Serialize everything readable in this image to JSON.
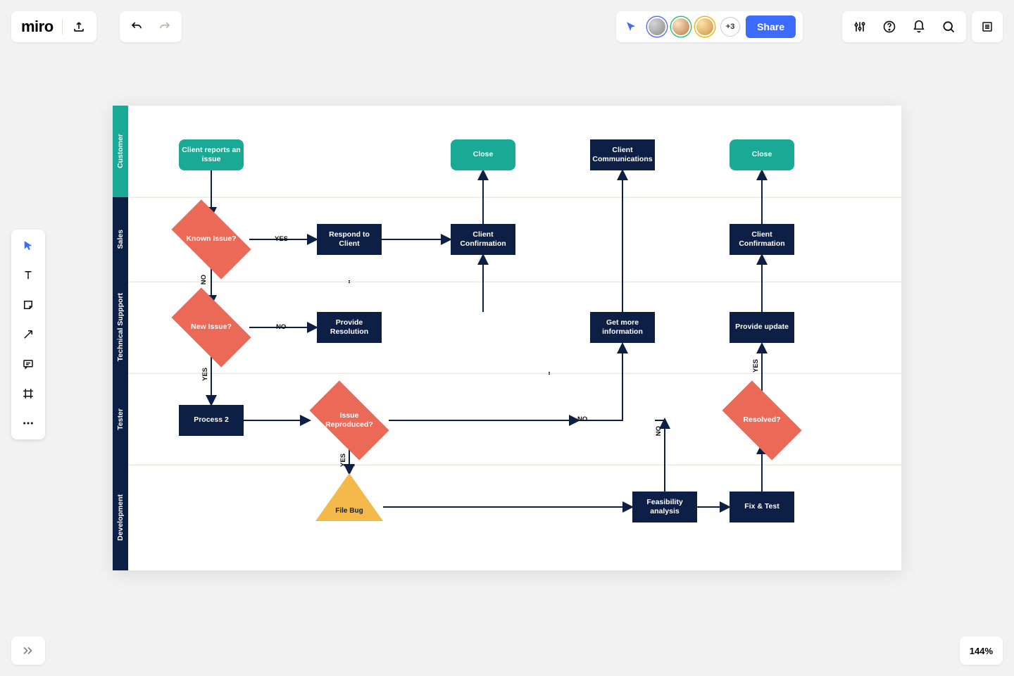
{
  "app": {
    "logo": "miro"
  },
  "toolbar": {
    "share": "Share",
    "more_users": "+3"
  },
  "zoom": "144%",
  "swimlanes": [
    "Customer",
    "Sales",
    "Technical Suppport",
    "Tester",
    "Development"
  ],
  "nodes": {
    "client_reports": "Client reports an issue",
    "close1": "Close",
    "client_comm": "Client Communications",
    "close2": "Close",
    "known_issue": "Known Issue?",
    "respond": "Respond to Client",
    "client_conf1": "Client Confirmation",
    "client_conf2": "Client Confirmation",
    "new_issue": "New Issue?",
    "provide_res": "Provide Resolution",
    "get_more": "Get more information",
    "provide_update": "Provide update",
    "process2": "Process 2",
    "issue_repro": "Issue Reproduced?",
    "resolved": "Resolved?",
    "file_bug": "File Bug",
    "feasibility": "Feasibility analysis",
    "fix_test": "Fix & Test"
  },
  "edges": {
    "yes": "YES",
    "no": "NO"
  },
  "chart_data": {
    "type": "swimlane-flowchart",
    "title": "",
    "lanes": [
      {
        "id": "customer",
        "label": "Customer"
      },
      {
        "id": "sales",
        "label": "Sales"
      },
      {
        "id": "tech",
        "label": "Technical Suppport"
      },
      {
        "id": "tester",
        "label": "Tester"
      },
      {
        "id": "dev",
        "label": "Development"
      }
    ],
    "nodes": [
      {
        "id": "client_reports",
        "lane": "customer",
        "shape": "rounded",
        "label": "Client reports an issue"
      },
      {
        "id": "close1",
        "lane": "customer",
        "shape": "rounded",
        "label": "Close"
      },
      {
        "id": "client_comm",
        "lane": "customer",
        "shape": "rect",
        "label": "Client Communications"
      },
      {
        "id": "close2",
        "lane": "customer",
        "shape": "rounded",
        "label": "Close"
      },
      {
        "id": "known_issue",
        "lane": "sales",
        "shape": "diamond",
        "label": "Known Issue?"
      },
      {
        "id": "respond",
        "lane": "sales",
        "shape": "rect",
        "label": "Respond to Client"
      },
      {
        "id": "client_conf1",
        "lane": "sales",
        "shape": "rect",
        "label": "Client Confirmation"
      },
      {
        "id": "client_conf2",
        "lane": "sales",
        "shape": "rect",
        "label": "Client Confirmation"
      },
      {
        "id": "new_issue",
        "lane": "tech",
        "shape": "diamond",
        "label": "New Issue?"
      },
      {
        "id": "provide_res",
        "lane": "tech",
        "shape": "rect",
        "label": "Provide Resolution"
      },
      {
        "id": "get_more",
        "lane": "tech",
        "shape": "rect",
        "label": "Get more information"
      },
      {
        "id": "provide_update",
        "lane": "tech",
        "shape": "rect",
        "label": "Provide update"
      },
      {
        "id": "process2",
        "lane": "tester",
        "shape": "rect",
        "label": "Process 2"
      },
      {
        "id": "issue_repro",
        "lane": "tester",
        "shape": "diamond",
        "label": "Issue Reproduced?"
      },
      {
        "id": "resolved",
        "lane": "tester",
        "shape": "diamond",
        "label": "Resolved?"
      },
      {
        "id": "file_bug",
        "lane": "dev",
        "shape": "triangle",
        "label": "File Bug"
      },
      {
        "id": "feasibility",
        "lane": "dev",
        "shape": "rect",
        "label": "Feasibility analysis"
      },
      {
        "id": "fix_test",
        "lane": "dev",
        "shape": "rect",
        "label": "Fix & Test"
      }
    ],
    "edges": [
      {
        "from": "client_reports",
        "to": "known_issue"
      },
      {
        "from": "known_issue",
        "to": "respond",
        "label": "YES"
      },
      {
        "from": "known_issue",
        "to": "new_issue",
        "label": "NO"
      },
      {
        "from": "respond",
        "to": "client_conf1"
      },
      {
        "from": "client_conf1",
        "to": "close1"
      },
      {
        "from": "new_issue",
        "to": "provide_res",
        "label": "NO"
      },
      {
        "from": "provide_res",
        "to": "client_conf1"
      },
      {
        "from": "new_issue",
        "to": "process2",
        "label": "YES"
      },
      {
        "from": "process2",
        "to": "issue_repro"
      },
      {
        "from": "issue_repro",
        "to": "file_bug",
        "label": "YES"
      },
      {
        "from": "issue_repro",
        "to": "get_more",
        "label": "NO"
      },
      {
        "from": "get_more",
        "to": "client_comm"
      },
      {
        "from": "file_bug",
        "to": "feasibility"
      },
      {
        "from": "feasibility",
        "to": "fix_test"
      },
      {
        "from": "feasibility",
        "to": "issue_repro",
        "label": "NO"
      },
      {
        "from": "fix_test",
        "to": "resolved"
      },
      {
        "from": "resolved",
        "to": "provide_update",
        "label": "YES"
      },
      {
        "from": "resolved",
        "to": "issue_repro",
        "label": "NO"
      },
      {
        "from": "provide_update",
        "to": "client_conf2"
      },
      {
        "from": "client_conf2",
        "to": "close2"
      }
    ]
  }
}
